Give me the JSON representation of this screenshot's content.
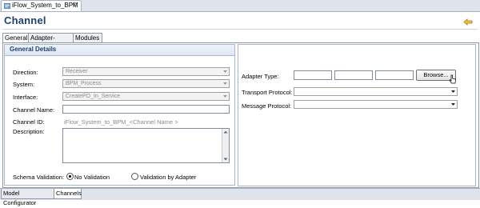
{
  "editor_tab": {
    "label": "iFlow_System_to_BPM",
    "close": "⊗"
  },
  "header": {
    "title": "Channel"
  },
  "tabs": [
    {
      "label": "General"
    },
    {
      "label": "Adapter-Specific"
    },
    {
      "label": "Modules"
    }
  ],
  "general_details": {
    "heading": "General Details",
    "direction": {
      "label": "Direction:",
      "value": "Receiver"
    },
    "system": {
      "label": "System:",
      "value": "BPM_Process"
    },
    "interface": {
      "label": "Interface:",
      "value": "CreatePO_In_Service"
    },
    "channel_name": {
      "label": "Channel Name:",
      "value": ""
    },
    "channel_id": {
      "label": "Channel ID:",
      "value": "iFlow_System_to_BPM_<Channel Name >"
    },
    "description": {
      "label": "Description:",
      "value": ""
    },
    "schema_validation": {
      "label": "Schema Validation:",
      "options": [
        {
          "label": "No Validation",
          "selected": true
        },
        {
          "label": "Validation by Adapter",
          "selected": false
        }
      ]
    }
  },
  "adapter": {
    "type": {
      "label": "Adapter Type:",
      "fields": [
        "",
        "",
        ""
      ],
      "browse_label": "Browse..."
    },
    "transport_protocol": {
      "label": "Transport Protocol:",
      "value": ""
    },
    "message_protocol": {
      "label": "Message Protocol:",
      "value": ""
    }
  },
  "bottom_tabs": [
    {
      "label": "Model Configurator"
    },
    {
      "label": "Channels"
    }
  ],
  "icons": {
    "back": "back-arrow-icon",
    "editor": "iflow-editor-icon",
    "dropdown": "chevron-down-icon"
  },
  "colors": {
    "title": "#1f3f6e",
    "section_border": "#a9b7cc",
    "disabled_text": "#8a8a8a"
  }
}
